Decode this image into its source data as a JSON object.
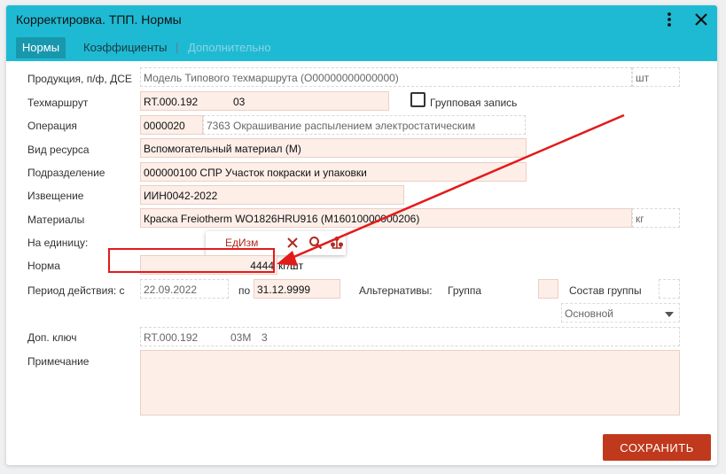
{
  "window": {
    "title": "Корректировка. ТПП. Нормы"
  },
  "tabs": [
    {
      "label": "Нормы",
      "active": true
    },
    {
      "label": "Коэффициенты",
      "active": false
    },
    {
      "label": "Дополнительно",
      "active": false
    }
  ],
  "tab_separator": "|",
  "form": {
    "product": {
      "label": "Продукция, п/ф, ДСЕ",
      "value": "Модель Типового техмаршрута (О00000000000000)",
      "unit": "шт"
    },
    "route": {
      "label": "Техмаршрут",
      "code": "RT.000.192",
      "number": "03"
    },
    "group_record": {
      "label": "Групповая запись",
      "checked": false
    },
    "operation": {
      "label": "Операция",
      "code": "0000020",
      "name": "7363 Окрашивание распылением электростатическим"
    },
    "resource_type": {
      "label": "Вид ресурса",
      "value": "Вспомогательный материал (М)"
    },
    "department": {
      "label": "Подразделение",
      "value": "000000100 СПР Участок покраски и упаковки"
    },
    "notice": {
      "label": "Извещение",
      "value": "ИИН0042-2022"
    },
    "materials": {
      "label": "Материалы",
      "value": "Краска Freiotherm WO1826HRU916 (М16010000000206)",
      "unit": "кг"
    },
    "per_unit": {
      "label": "На единицу:"
    },
    "norm": {
      "label": "Норма",
      "value": "4444",
      "unit": "кг/шт"
    },
    "period": {
      "label": "Период действия: с",
      "from": "22.09.2022",
      "to_label": "по",
      "to": "31.12.9999"
    },
    "alternatives": {
      "label": "Альтернативы:",
      "group_label": "Группа",
      "composition_label": "Состав группы",
      "type_value": "Основной"
    },
    "extra_key": {
      "label": "Доп. ключ",
      "code": "RT.000.192",
      "sub": "03М",
      "num": "3"
    },
    "note": {
      "label": "Примечание",
      "value": ""
    }
  },
  "popup": {
    "edizm_label": "ЕдИзм"
  },
  "buttons": {
    "save": "СОХРАНИТЬ"
  },
  "colors": {
    "header": "#1ebad3",
    "accent": "#c0391c",
    "editable_bg": "#fdeee8",
    "annotation": "#e21a1a"
  },
  "icons": [
    "more-vert-icon",
    "close-icon",
    "clear-icon",
    "search-icon",
    "tree-icon"
  ]
}
